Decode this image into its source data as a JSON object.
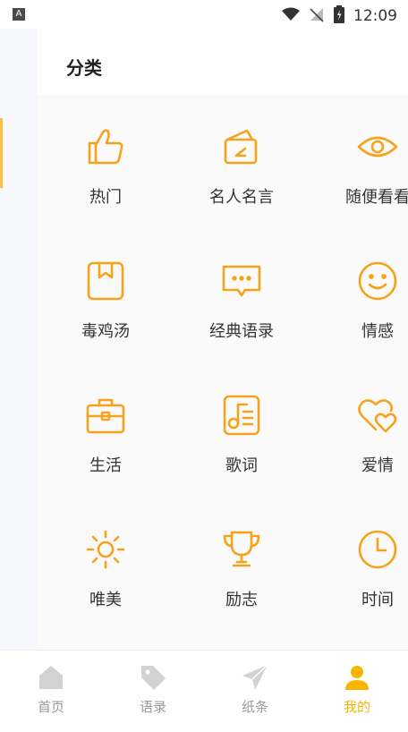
{
  "status_bar": {
    "time": "12:09",
    "left_badge": "A"
  },
  "page": {
    "title": "分类"
  },
  "categories": [
    {
      "label": "热门",
      "icon": "thumbs-up-icon"
    },
    {
      "label": "名人名言",
      "icon": "cards-icon"
    },
    {
      "label": "随便看看",
      "icon": "eye-icon"
    },
    {
      "label": "毒鸡汤",
      "icon": "bookmark-icon"
    },
    {
      "label": "经典语录",
      "icon": "message-icon"
    },
    {
      "label": "情感",
      "icon": "smile-icon"
    },
    {
      "label": "生活",
      "icon": "briefcase-icon"
    },
    {
      "label": "歌词",
      "icon": "music-note-icon"
    },
    {
      "label": "爱情",
      "icon": "hearts-icon"
    },
    {
      "label": "唯美",
      "icon": "sun-icon"
    },
    {
      "label": "励志",
      "icon": "trophy-icon"
    },
    {
      "label": "时间",
      "icon": "clock-icon"
    }
  ],
  "tabs": [
    {
      "label": "首页",
      "icon": "home-icon"
    },
    {
      "label": "语录",
      "icon": "tag-icon"
    },
    {
      "label": "纸条",
      "icon": "paper-plane-icon"
    },
    {
      "label": "我的",
      "icon": "user-icon",
      "active": true
    }
  ],
  "colors": {
    "accent": "#f7b500",
    "icon_stroke": "#f7a21b",
    "inactive": "#c8c8c8"
  }
}
